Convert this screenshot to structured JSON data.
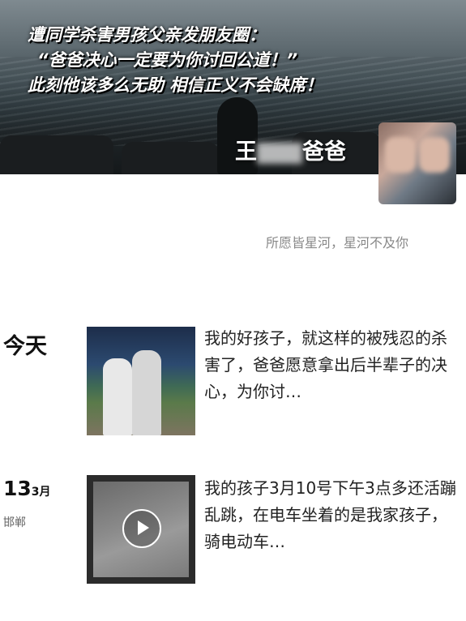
{
  "cover": {
    "headline": [
      "遭同学杀害男孩父亲发朋友圈：",
      "“爸爸决心一定要为你讨回公道！”",
      "此刻他该多么无助 相信正义不会缺席！"
    ],
    "name_prefix": "王",
    "name_suffix": "爸爸"
  },
  "profile": {
    "signature": "所愿皆星河，星河不及你"
  },
  "posts": [
    {
      "date": "今天",
      "text": "我的好孩子，就这样的被残忍的杀害了，爸爸愿意拿出后半辈子的决心，为你讨…",
      "media": "photo"
    },
    {
      "day": "13",
      "month": "3月",
      "location": "邯郸",
      "text": "我的孩子3月10号下午3点多还活蹦乱跳，在电车坐着的是我家孩子，骑电动车…",
      "media": "video"
    }
  ],
  "icons": {
    "play": "play-icon"
  }
}
